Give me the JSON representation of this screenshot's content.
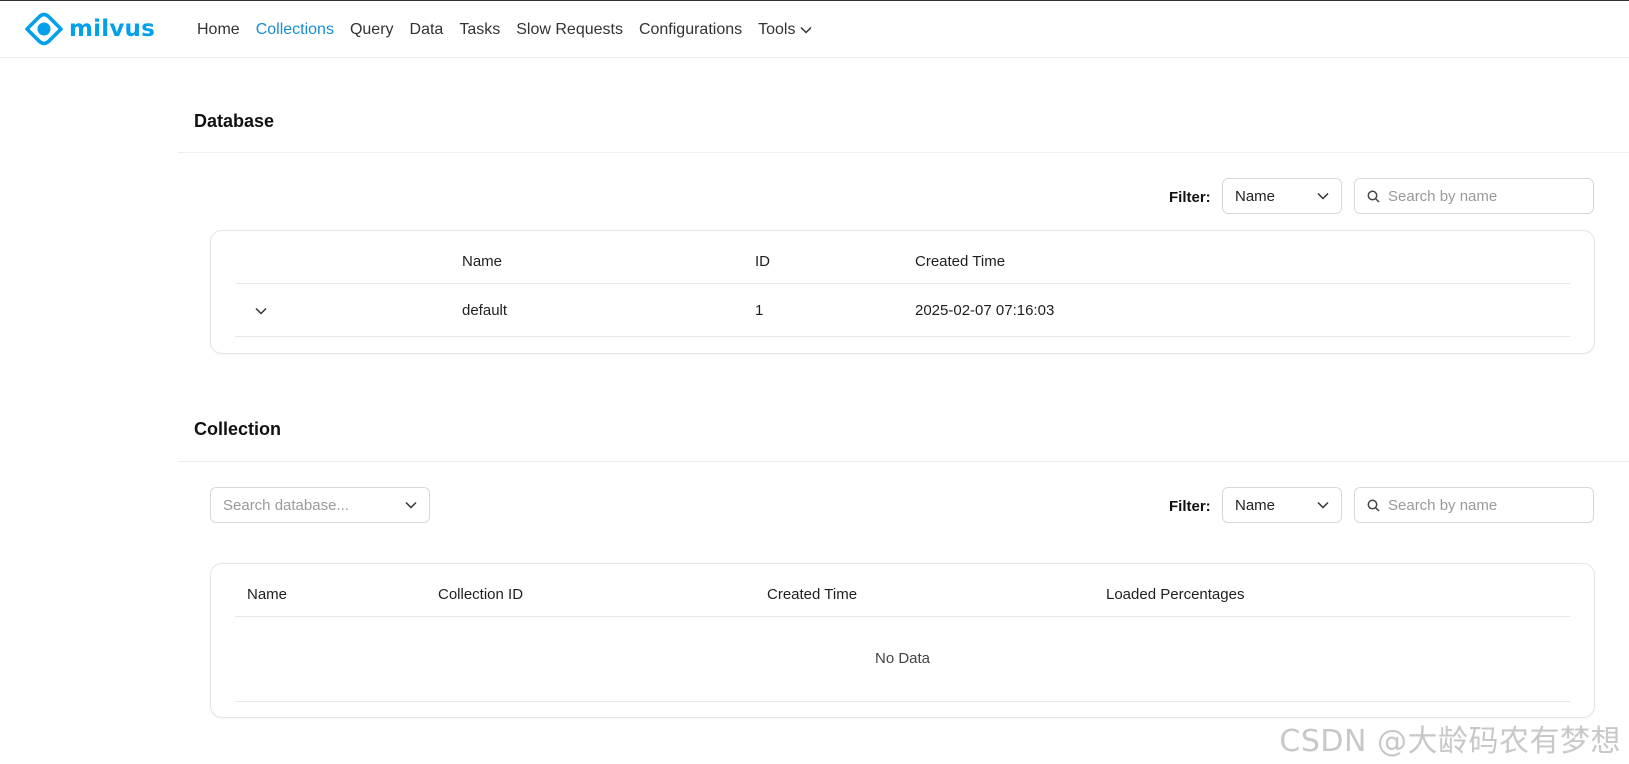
{
  "app": {
    "brand": "milvus",
    "accent_color": "#00a1ea",
    "active_nav_color": "#1a8bd2"
  },
  "nav": {
    "items": [
      {
        "label": "Home",
        "active": false
      },
      {
        "label": "Collections",
        "active": true
      },
      {
        "label": "Query",
        "active": false
      },
      {
        "label": "Data",
        "active": false
      },
      {
        "label": "Tasks",
        "active": false
      },
      {
        "label": "Slow Requests",
        "active": false
      },
      {
        "label": "Configurations",
        "active": false
      },
      {
        "label": "Tools",
        "active": false,
        "icon": "chevron-down-icon"
      }
    ]
  },
  "database": {
    "title": "Database",
    "filter_label": "Filter:",
    "filter_select_value": "Name",
    "search_placeholder": "Search by name",
    "columns": [
      "Name",
      "ID",
      "Created Time"
    ],
    "rows": [
      {
        "expand_icon": "chevron-down-icon",
        "name": "default",
        "id": "1",
        "created_time": "2025-02-07 07:16:03"
      }
    ]
  },
  "collection": {
    "title": "Collection",
    "database_select_placeholder": "Search database...",
    "filter_label": "Filter:",
    "filter_select_value": "Name",
    "search_placeholder": "Search by name",
    "columns": [
      "Name",
      "Collection ID",
      "Created Time",
      "Loaded Percentages"
    ],
    "empty_text": "No Data"
  },
  "watermark": "CSDN @大龄码农有梦想"
}
